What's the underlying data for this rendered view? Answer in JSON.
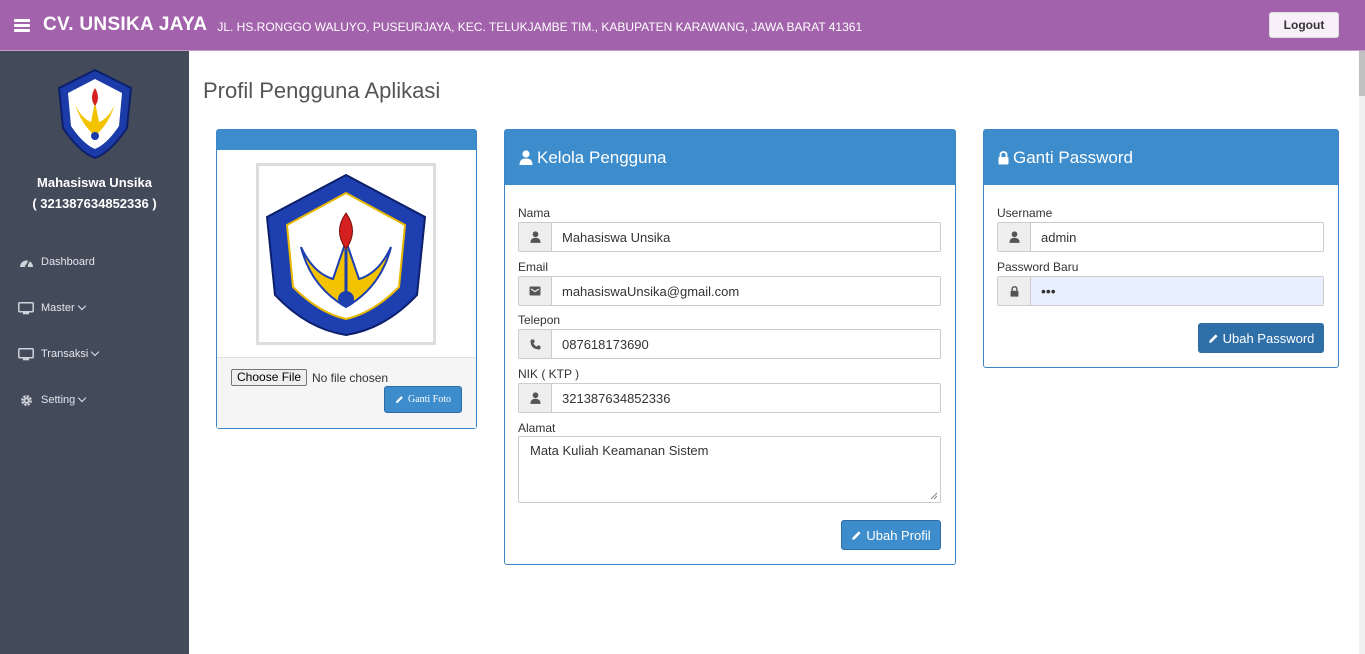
{
  "header": {
    "brand": "CV. UNSIKA JAYA",
    "address": "JL. HS.RONGGO WALUYO, PUSEURJAYA, KEC. TELUKJAMBE TIM., KABUPATEN KARAWANG, JAWA BARAT 41361",
    "logout_label": "Logout",
    "menu_icon": "hamburger-icon"
  },
  "sidebar": {
    "user_name": "Mahasiswa Unsika",
    "user_id": "( 321387634852336 )",
    "items": [
      {
        "label": "Dashboard",
        "icon": "dashboard-icon"
      },
      {
        "label": "Master",
        "icon": "monitor-icon"
      },
      {
        "label": "Transaksi",
        "icon": "monitor-icon"
      },
      {
        "label": "Setting",
        "icon": "gear-icon"
      }
    ]
  },
  "main": {
    "page_title": "Profil Pengguna Aplikasi",
    "photo_panel": {
      "choose_file": "Choose File",
      "no_file": "No file chosen",
      "ganti_foto": "Ganti Foto"
    },
    "kelola": {
      "title": "Kelola Pengguna",
      "nama_label": "Nama",
      "nama_value": "Mahasiswa Unsika",
      "email_label": "Email",
      "email_value": "mahasiswaUnsika@gmail.com",
      "telepon_label": "Telepon",
      "telepon_value": "087618173690",
      "nik_label": "NIK ( KTP )",
      "nik_value": "321387634852336",
      "alamat_label": "Alamat",
      "alamat_value": "Mata Kuliah Keamanan Sistem",
      "submit_label": "Ubah Profil"
    },
    "password": {
      "title": "Ganti Password",
      "username_label": "Username",
      "username_value": "admin",
      "password_label": "Password Baru",
      "password_value": "•••",
      "submit_label": "Ubah Password"
    }
  },
  "colors": {
    "topbar": "#a363ac",
    "sidebar": "#434a5a",
    "primary": "#3d8ccb"
  }
}
